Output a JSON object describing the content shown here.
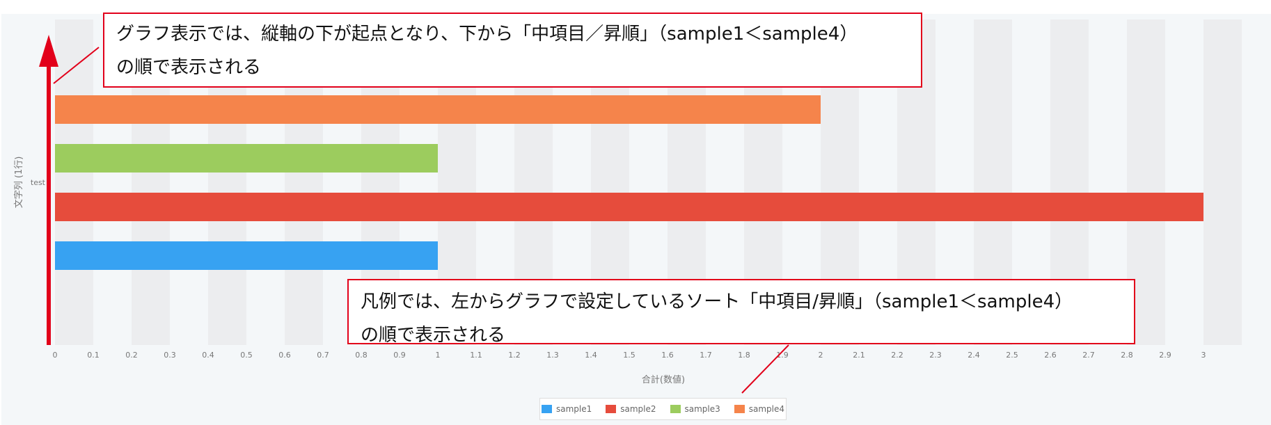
{
  "chart_data": {
    "type": "bar",
    "orientation": "horizontal",
    "categories": [
      "test"
    ],
    "series": [
      {
        "name": "sample1",
        "values": [
          1
        ],
        "color": "#37a2f2"
      },
      {
        "name": "sample2",
        "values": [
          3
        ],
        "color": "#e64c3c"
      },
      {
        "name": "sample3",
        "values": [
          1
        ],
        "color": "#9ccc5e"
      },
      {
        "name": "sample4",
        "values": [
          2
        ],
        "color": "#f5844b"
      }
    ],
    "xlabel": "合計(数値)",
    "ylabel": "文字列 (1行)",
    "xlim": [
      0,
      3.1
    ],
    "xticks": [
      "0",
      "0.1",
      "0.2",
      "0.3",
      "0.4",
      "0.5",
      "0.6",
      "0.7",
      "0.8",
      "0.9",
      "1",
      "1.1",
      "1.2",
      "1.3",
      "1.4",
      "1.5",
      "1.6",
      "1.7",
      "1.8",
      "1.9",
      "2",
      "2.1",
      "2.2",
      "2.3",
      "2.4",
      "2.5",
      "2.6",
      "2.7",
      "2.8",
      "2.9",
      "3"
    ],
    "grid": "alternating vertical bands",
    "legend_position": "bottom-center"
  },
  "annotations": {
    "top_line1": "グラフ表示では、縦軸の下が起点となり、下から「中項目／昇順」（sample1＜sample4）",
    "top_line2": "の順で表示される",
    "bottom_line1": "凡例では、左からグラフで設定しているソート「中項目/昇順」（sample1＜sample4）",
    "bottom_line2": "の順で表示される",
    "arrow_color": "#e2001a"
  }
}
